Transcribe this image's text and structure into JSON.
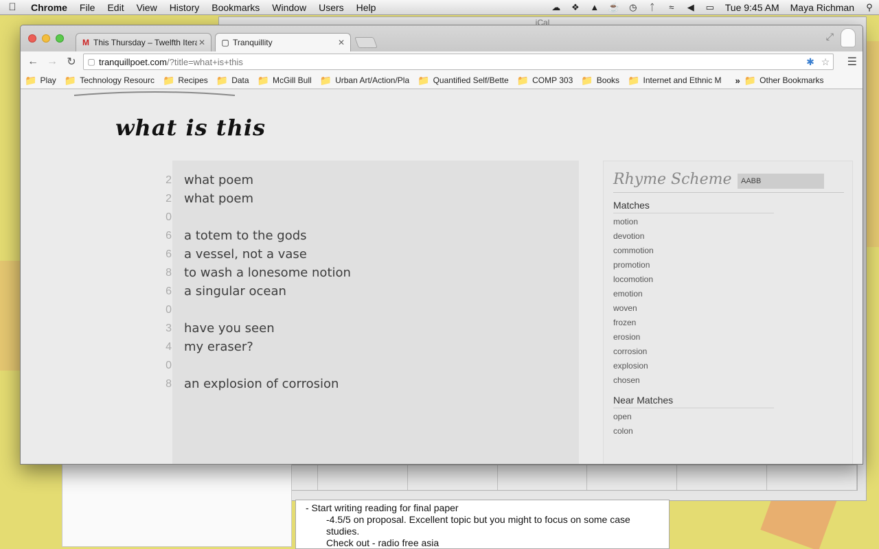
{
  "menubar": {
    "app_name": "Chrome",
    "items": [
      "File",
      "Edit",
      "View",
      "History",
      "Bookmarks",
      "Window",
      "Users",
      "Help"
    ],
    "clock": "Tue 9:45 AM",
    "user": "Maya Richman"
  },
  "background_windows": {
    "ical_title": "iCal",
    "notes_lines": [
      "- Start writing reading for final paper",
      "-4.5/5 on proposal.  Excellent topic but you might to focus on some case",
      "studies.",
      "Check out - radio free asia"
    ]
  },
  "browser": {
    "tabs": [
      {
        "title": "This Thursday – Twelfth Itera",
        "favicon": "gmail-icon",
        "active": false
      },
      {
        "title": "Tranquillity",
        "favicon": "page-icon",
        "active": true
      }
    ],
    "url_host": "tranquillpoet.com",
    "url_path": "/?title=what+is+this",
    "bookmarks": [
      "Play",
      "Technology Resourc",
      "Recipes",
      "Data",
      "McGill Bull",
      "Urban Art/Action/Pla",
      "Quantified Self/Bette",
      "COMP 303",
      "Books",
      "Internet and Ethnic M"
    ],
    "bookmarks_overflow": "»",
    "other_bookmarks": "Other Bookmarks"
  },
  "poem": {
    "title": "what is this",
    "lines": [
      {
        "syllables": "2",
        "text": "what poem"
      },
      {
        "syllables": "2",
        "text": "what poem"
      },
      {
        "syllables": "0",
        "text": ""
      },
      {
        "syllables": "6",
        "text": "a totem to the gods"
      },
      {
        "syllables": "6",
        "text": "a vessel, not a vase"
      },
      {
        "syllables": "8",
        "text": "to wash a lonesome notion"
      },
      {
        "syllables": "6",
        "text": "a singular ocean"
      },
      {
        "syllables": "0",
        "text": ""
      },
      {
        "syllables": "3",
        "text": "have you seen"
      },
      {
        "syllables": "4",
        "text": "my eraser?"
      },
      {
        "syllables": "0",
        "text": ""
      },
      {
        "syllables": "8",
        "text": "an explosion of corrosion"
      }
    ]
  },
  "rhyme_panel": {
    "title": "Rhyme Scheme",
    "scheme_value": "AABB",
    "matches_label": "Matches",
    "matches": [
      "motion",
      "devotion",
      "commotion",
      "promotion",
      "locomotion",
      "emotion",
      "woven",
      "frozen",
      "erosion",
      "corrosion",
      "explosion",
      "chosen"
    ],
    "near_matches_label": "Near Matches",
    "near_matches": [
      "open",
      "colon"
    ]
  }
}
